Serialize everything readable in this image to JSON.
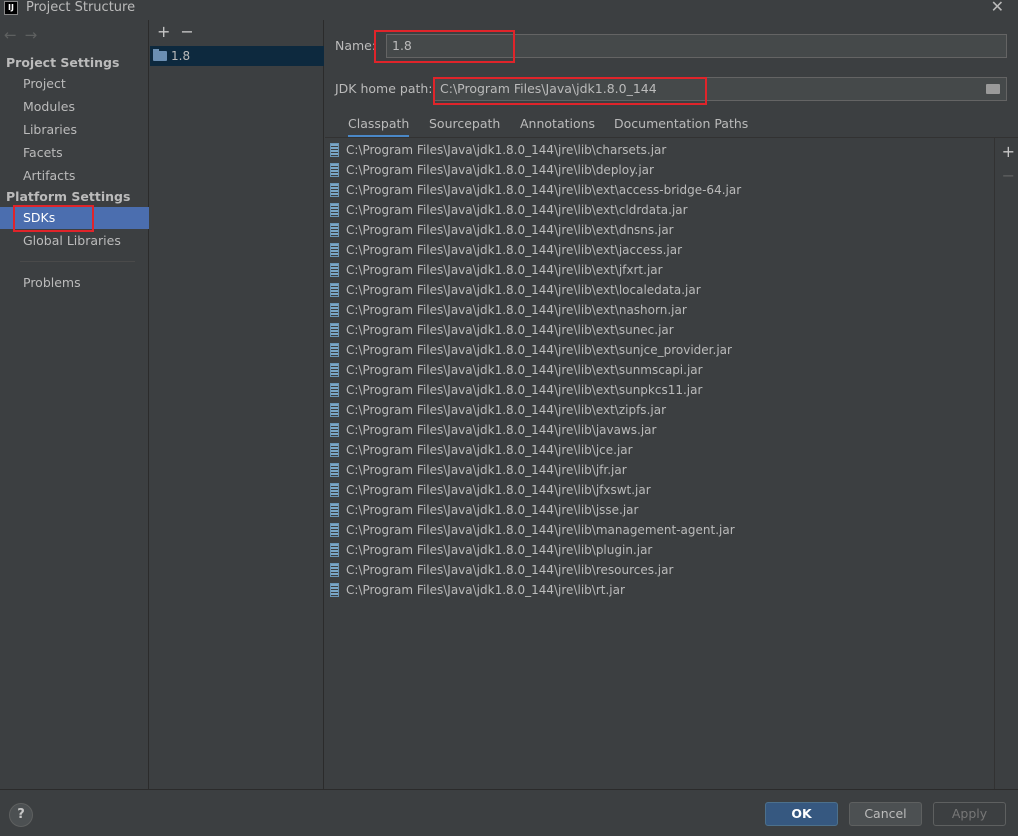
{
  "window": {
    "title": "Project Structure",
    "logo_text": "IJ",
    "close_glyph": "✕"
  },
  "nav": {
    "back": "←",
    "forward": "→",
    "project_settings_header": "Project Settings",
    "project_items": [
      "Project",
      "Modules",
      "Libraries",
      "Facets",
      "Artifacts"
    ],
    "platform_settings_header": "Platform Settings",
    "platform_items": [
      "SDKs",
      "Global Libraries"
    ],
    "problems": "Problems",
    "selected": "SDKs"
  },
  "sdk_list": {
    "add": "+",
    "remove": "−",
    "items": [
      "1.8"
    ]
  },
  "form": {
    "name_label": "Name:",
    "name_value": "1.8",
    "jdk_home_label": "JDK home path:",
    "jdk_home_value": "C:\\Program Files\\Java\\jdk1.8.0_144"
  },
  "tabs": [
    "Classpath",
    "Sourcepath",
    "Annotations",
    "Documentation Paths"
  ],
  "active_tab": "Classpath",
  "classpath": [
    "C:\\Program Files\\Java\\jdk1.8.0_144\\jre\\lib\\charsets.jar",
    "C:\\Program Files\\Java\\jdk1.8.0_144\\jre\\lib\\deploy.jar",
    "C:\\Program Files\\Java\\jdk1.8.0_144\\jre\\lib\\ext\\access-bridge-64.jar",
    "C:\\Program Files\\Java\\jdk1.8.0_144\\jre\\lib\\ext\\cldrdata.jar",
    "C:\\Program Files\\Java\\jdk1.8.0_144\\jre\\lib\\ext\\dnsns.jar",
    "C:\\Program Files\\Java\\jdk1.8.0_144\\jre\\lib\\ext\\jaccess.jar",
    "C:\\Program Files\\Java\\jdk1.8.0_144\\jre\\lib\\ext\\jfxrt.jar",
    "C:\\Program Files\\Java\\jdk1.8.0_144\\jre\\lib\\ext\\localedata.jar",
    "C:\\Program Files\\Java\\jdk1.8.0_144\\jre\\lib\\ext\\nashorn.jar",
    "C:\\Program Files\\Java\\jdk1.8.0_144\\jre\\lib\\ext\\sunec.jar",
    "C:\\Program Files\\Java\\jdk1.8.0_144\\jre\\lib\\ext\\sunjce_provider.jar",
    "C:\\Program Files\\Java\\jdk1.8.0_144\\jre\\lib\\ext\\sunmscapi.jar",
    "C:\\Program Files\\Java\\jdk1.8.0_144\\jre\\lib\\ext\\sunpkcs11.jar",
    "C:\\Program Files\\Java\\jdk1.8.0_144\\jre\\lib\\ext\\zipfs.jar",
    "C:\\Program Files\\Java\\jdk1.8.0_144\\jre\\lib\\javaws.jar",
    "C:\\Program Files\\Java\\jdk1.8.0_144\\jre\\lib\\jce.jar",
    "C:\\Program Files\\Java\\jdk1.8.0_144\\jre\\lib\\jfr.jar",
    "C:\\Program Files\\Java\\jdk1.8.0_144\\jre\\lib\\jfxswt.jar",
    "C:\\Program Files\\Java\\jdk1.8.0_144\\jre\\lib\\jsse.jar",
    "C:\\Program Files\\Java\\jdk1.8.0_144\\jre\\lib\\management-agent.jar",
    "C:\\Program Files\\Java\\jdk1.8.0_144\\jre\\lib\\plugin.jar",
    "C:\\Program Files\\Java\\jdk1.8.0_144\\jre\\lib\\resources.jar",
    "C:\\Program Files\\Java\\jdk1.8.0_144\\jre\\lib\\rt.jar"
  ],
  "list_side": {
    "add": "+",
    "remove": "−"
  },
  "footer": {
    "help": "?",
    "ok": "OK",
    "cancel": "Cancel",
    "apply": "Apply"
  },
  "colors": {
    "background": "#3c3f41",
    "selection": "#4b6eaf",
    "highlight_box": "#e0242a",
    "ok_button": "#365880"
  }
}
